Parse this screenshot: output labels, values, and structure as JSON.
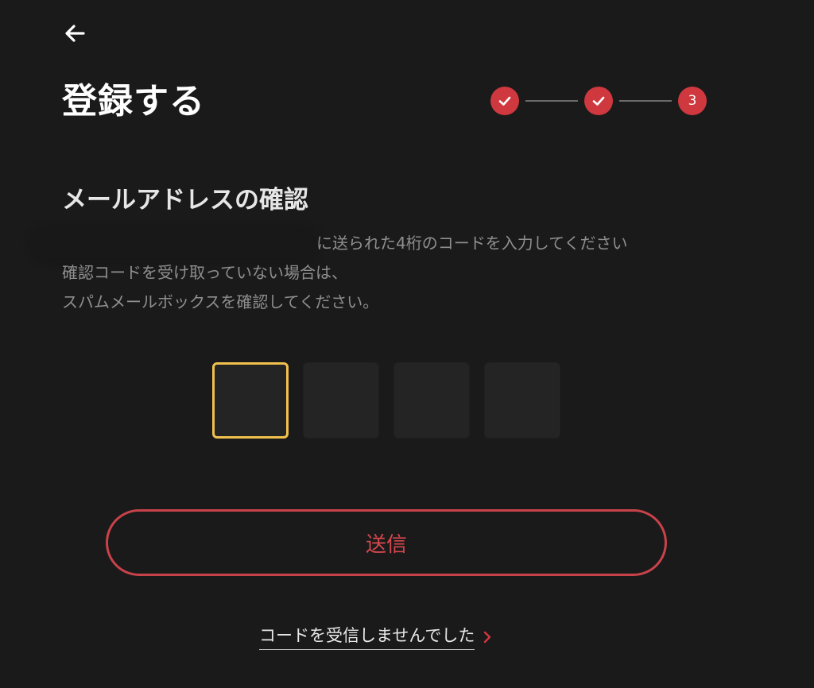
{
  "header": {
    "back_icon": "arrow-left-icon",
    "title": "登録する"
  },
  "stepper": {
    "steps": [
      {
        "state": "done",
        "icon": "check-icon",
        "label": ""
      },
      {
        "state": "done",
        "icon": "check-icon",
        "label": ""
      },
      {
        "state": "current",
        "label": "3"
      }
    ],
    "accent_color": "#d0383f"
  },
  "verification": {
    "title": "メールアドレスの確認",
    "line1_suffix": "に送られた4桁のコードを入力してください",
    "line2": "確認コードを受け取っていない場合は、",
    "line3": "スパムメールボックスを確認してください。"
  },
  "code_input": {
    "digits": [
      "",
      "",
      "",
      ""
    ],
    "active_index": 0,
    "active_border_color": "#f1c14e"
  },
  "submit": {
    "label": "送信",
    "border_color": "#c8424a"
  },
  "resend": {
    "label": "コードを受信しませんでした",
    "icon": "chevron-right-icon"
  }
}
